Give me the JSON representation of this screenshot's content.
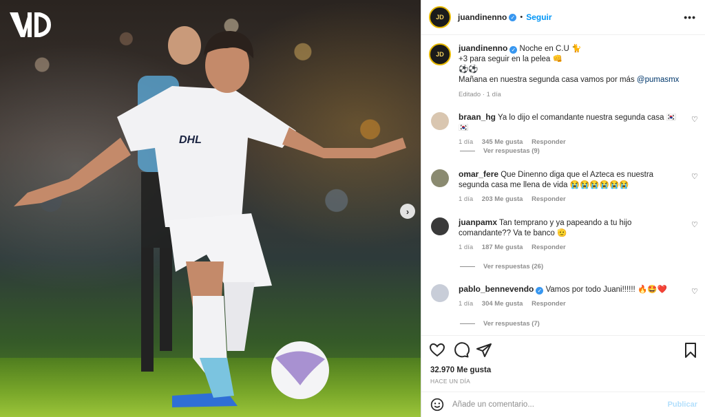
{
  "header": {
    "username": "juandinenno",
    "follow_label": "Seguir",
    "separator": "•",
    "more_label": "•••",
    "avatar_text": "JD"
  },
  "caption": {
    "username": "juandinenno",
    "line1": "Noche en C.U 🐈",
    "line2": "+3 para seguir en la pelea 👊",
    "line3": "⚽⚽",
    "line4_text": "Mañana en nuestra segunda casa vamos por más ",
    "line4_mention": "@pumasmx",
    "meta": "Editado · 1 día"
  },
  "comments": [
    {
      "username": "braan_hg",
      "text": "Ya lo dijo el comandante nuestra segunda casa 🇰🇷🇰🇷",
      "time": "1 día",
      "likes": "345 Me gusta",
      "reply": "Responder",
      "replies": "Ver respuestas (9)"
    },
    {
      "username": "omar_fere",
      "text": "Que Dinenno diga que el Azteca es nuestra segunda casa me llena de vida 😭😭😭😭😭😭",
      "time": "1 día",
      "likes": "203 Me gusta",
      "reply": "Responder"
    },
    {
      "username": "juanpamx",
      "text": "Tan temprano y ya papeando a tu hijo comandante?? Va te banco 🫡",
      "time": "1 día",
      "likes": "187 Me gusta",
      "reply": "Responder",
      "replies": "Ver respuestas (26)"
    },
    {
      "username": "pablo_bennevendo",
      "text": "Vamos por todo Juani!!!!!! 🔥🤩❤️",
      "time": "1 día",
      "likes": "304 Me gusta",
      "reply": "Responder",
      "replies": "Ver respuestas (7)"
    }
  ],
  "actions": {
    "likes": "32.970 Me gusta",
    "ago": "HACE UN DÍA"
  },
  "add_comment": {
    "placeholder": "Añade un comentario...",
    "publish": "Publicar"
  },
  "media": {
    "logo_text": "VID",
    "next_arrow": "›"
  },
  "colors": {
    "accent": "#0095f6",
    "verified": "#3897f0",
    "muted": "#8e8e8e",
    "border": "#dbdbdb"
  }
}
